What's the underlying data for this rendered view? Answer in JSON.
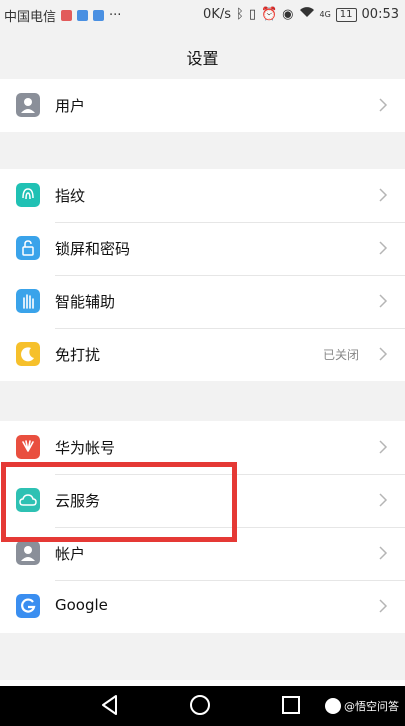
{
  "status_bar": {
    "carrier": "中国电信",
    "speed": "0K/s",
    "network": "4G",
    "battery": "11",
    "time": "00:53"
  },
  "header": {
    "title": "设置"
  },
  "groups": [
    {
      "items": [
        {
          "label": "用户",
          "icon": "user-icon"
        }
      ]
    },
    {
      "items": [
        {
          "label": "指纹",
          "icon": "fingerprint-icon"
        },
        {
          "label": "锁屏和密码",
          "icon": "lock-icon"
        },
        {
          "label": "智能辅助",
          "icon": "hand-icon"
        },
        {
          "label": "免打扰",
          "icon": "moon-icon",
          "value": "已关闭"
        }
      ]
    },
    {
      "items": [
        {
          "label": "华为帐号",
          "icon": "huawei-icon"
        },
        {
          "label": "云服务",
          "icon": "cloud-icon"
        },
        {
          "label": "帐户",
          "icon": "account-icon"
        },
        {
          "label": "Google",
          "icon": "google-icon"
        }
      ]
    }
  ],
  "watermark": "@悟空问答",
  "colors": {
    "user": "#8a8f99",
    "fingerprint": "#20c1b4",
    "lock": "#3aa3ea",
    "hand": "#3aa3ea",
    "moon": "#f6c02b",
    "huawei": "#e94f3f",
    "cloud": "#2ec1b3",
    "account": "#8a8f99",
    "google": "#3a8ef0",
    "highlight": "#e53935"
  }
}
